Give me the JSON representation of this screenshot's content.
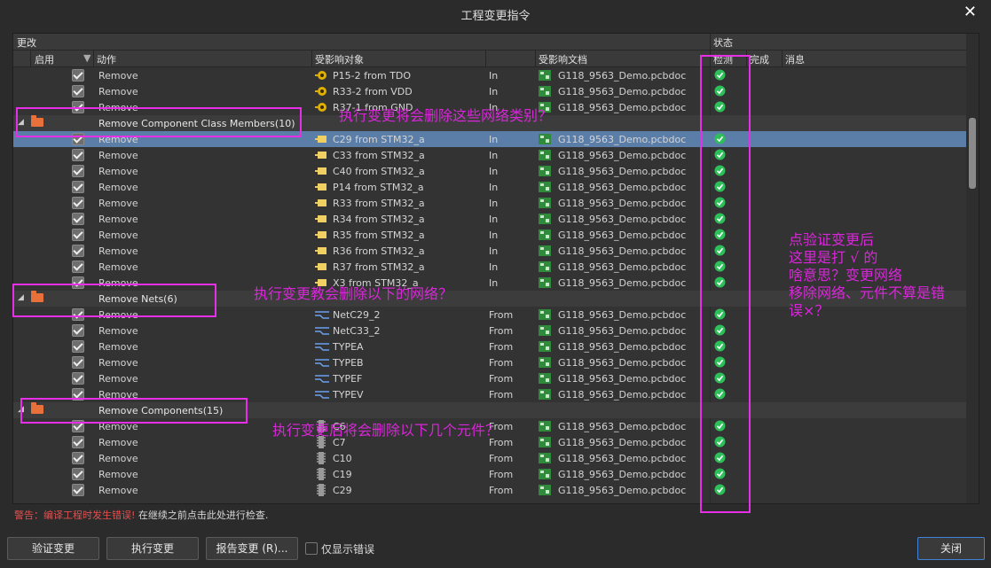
{
  "window": {
    "title": "工程变更指令"
  },
  "headers": {
    "group_change": "更改",
    "group_status": "状态",
    "col_enable": "启用",
    "col_action": "动作",
    "col_object": "受影响对象",
    "col_document": "受影响文档",
    "col_check": "检测",
    "col_done": "完成",
    "col_message": "消息"
  },
  "rows": [
    {
      "type": "item",
      "action": "Remove",
      "icon": "pin-icon",
      "object": "P15-2 from TDO",
      "dir": "In",
      "doc": "G118_9563_Demo.pcbdoc"
    },
    {
      "type": "item",
      "action": "Remove",
      "icon": "pin-icon",
      "object": "R33-2 from VDD",
      "dir": "In",
      "doc": "G118_9563_Demo.pcbdoc"
    },
    {
      "type": "item",
      "action": "Remove",
      "icon": "pin-icon",
      "object": "R37-1 from GND",
      "dir": "In",
      "doc": "G118_9563_Demo.pcbdoc"
    },
    {
      "type": "group",
      "label": "Remove Component Class Members(10)"
    },
    {
      "type": "item",
      "selected": true,
      "action": "Remove",
      "icon": "class-member-icon",
      "object": "C29 from STM32_a",
      "dir": "In",
      "doc": "G118_9563_Demo.pcbdoc"
    },
    {
      "type": "item",
      "action": "Remove",
      "icon": "class-member-icon",
      "object": "C33 from STM32_a",
      "dir": "In",
      "doc": "G118_9563_Demo.pcbdoc"
    },
    {
      "type": "item",
      "action": "Remove",
      "icon": "class-member-icon",
      "object": "C40 from STM32_a",
      "dir": "In",
      "doc": "G118_9563_Demo.pcbdoc"
    },
    {
      "type": "item",
      "action": "Remove",
      "icon": "class-member-icon",
      "object": "P14 from STM32_a",
      "dir": "In",
      "doc": "G118_9563_Demo.pcbdoc"
    },
    {
      "type": "item",
      "action": "Remove",
      "icon": "class-member-icon",
      "object": "R33 from STM32_a",
      "dir": "In",
      "doc": "G118_9563_Demo.pcbdoc"
    },
    {
      "type": "item",
      "action": "Remove",
      "icon": "class-member-icon",
      "object": "R34 from STM32_a",
      "dir": "In",
      "doc": "G118_9563_Demo.pcbdoc"
    },
    {
      "type": "item",
      "action": "Remove",
      "icon": "class-member-icon",
      "object": "R35 from STM32_a",
      "dir": "In",
      "doc": "G118_9563_Demo.pcbdoc"
    },
    {
      "type": "item",
      "action": "Remove",
      "icon": "class-member-icon",
      "object": "R36 from STM32_a",
      "dir": "In",
      "doc": "G118_9563_Demo.pcbdoc"
    },
    {
      "type": "item",
      "action": "Remove",
      "icon": "class-member-icon",
      "object": "R37 from STM32_a",
      "dir": "In",
      "doc": "G118_9563_Demo.pcbdoc"
    },
    {
      "type": "item",
      "action": "Remove",
      "icon": "class-member-icon",
      "object": "X3 from STM32_a",
      "dir": "In",
      "doc": "G118_9563_Demo.pcbdoc"
    },
    {
      "type": "group",
      "label": "Remove Nets(6)"
    },
    {
      "type": "item",
      "action": "Remove",
      "icon": "net-icon",
      "object": "NetC29_2",
      "dir": "From",
      "doc": "G118_9563_Demo.pcbdoc"
    },
    {
      "type": "item",
      "action": "Remove",
      "icon": "net-icon",
      "object": "NetC33_2",
      "dir": "From",
      "doc": "G118_9563_Demo.pcbdoc"
    },
    {
      "type": "item",
      "action": "Remove",
      "icon": "net-icon",
      "object": "TYPEA",
      "dir": "From",
      "doc": "G118_9563_Demo.pcbdoc"
    },
    {
      "type": "item",
      "action": "Remove",
      "icon": "net-icon",
      "object": "TYPEB",
      "dir": "From",
      "doc": "G118_9563_Demo.pcbdoc"
    },
    {
      "type": "item",
      "action": "Remove",
      "icon": "net-icon",
      "object": "TYPEF",
      "dir": "From",
      "doc": "G118_9563_Demo.pcbdoc"
    },
    {
      "type": "item",
      "action": "Remove",
      "icon": "net-icon",
      "object": "TYPEV",
      "dir": "From",
      "doc": "G118_9563_Demo.pcbdoc"
    },
    {
      "type": "group",
      "label": "Remove Components(15)"
    },
    {
      "type": "item",
      "action": "Remove",
      "icon": "component-icon",
      "object": "C6",
      "dir": "From",
      "doc": "G118_9563_Demo.pcbdoc"
    },
    {
      "type": "item",
      "action": "Remove",
      "icon": "component-icon",
      "object": "C7",
      "dir": "From",
      "doc": "G118_9563_Demo.pcbdoc"
    },
    {
      "type": "item",
      "action": "Remove",
      "icon": "component-icon",
      "object": "C10",
      "dir": "From",
      "doc": "G118_9563_Demo.pcbdoc"
    },
    {
      "type": "item",
      "action": "Remove",
      "icon": "component-icon",
      "object": "C19",
      "dir": "From",
      "doc": "G118_9563_Demo.pcbdoc"
    },
    {
      "type": "item",
      "action": "Remove",
      "icon": "component-icon",
      "object": "C29",
      "dir": "From",
      "doc": "G118_9563_Demo.pcbdoc"
    }
  ],
  "warning": {
    "label": "警告：编译工程时发生错误!",
    "text": "在继续之前点击此处进行检查."
  },
  "buttons": {
    "validate": "验证变更",
    "execute": "执行变更",
    "report": "报告变更 (R)...",
    "only_errors": "仅显示错误",
    "close": "关闭"
  },
  "annotations": {
    "a1": "执行变更将会删除这些网络类别？",
    "a2": "执行变更教会删除以下的网络？",
    "a3": "执行变更后将会删除以下几个元件？",
    "a4_l1": "点验证变更后",
    "a4_l2": "这里是打 √ 的",
    "a4_l3": "啥意思？变更网络",
    "a4_l4": "移除网络、元件不算是错",
    "a4_l5": "误×？"
  },
  "colors": {
    "accent": "#e62fe6",
    "selection": "#5b7ea8",
    "ok": "#2fbf5a",
    "warning": "#e05050"
  }
}
